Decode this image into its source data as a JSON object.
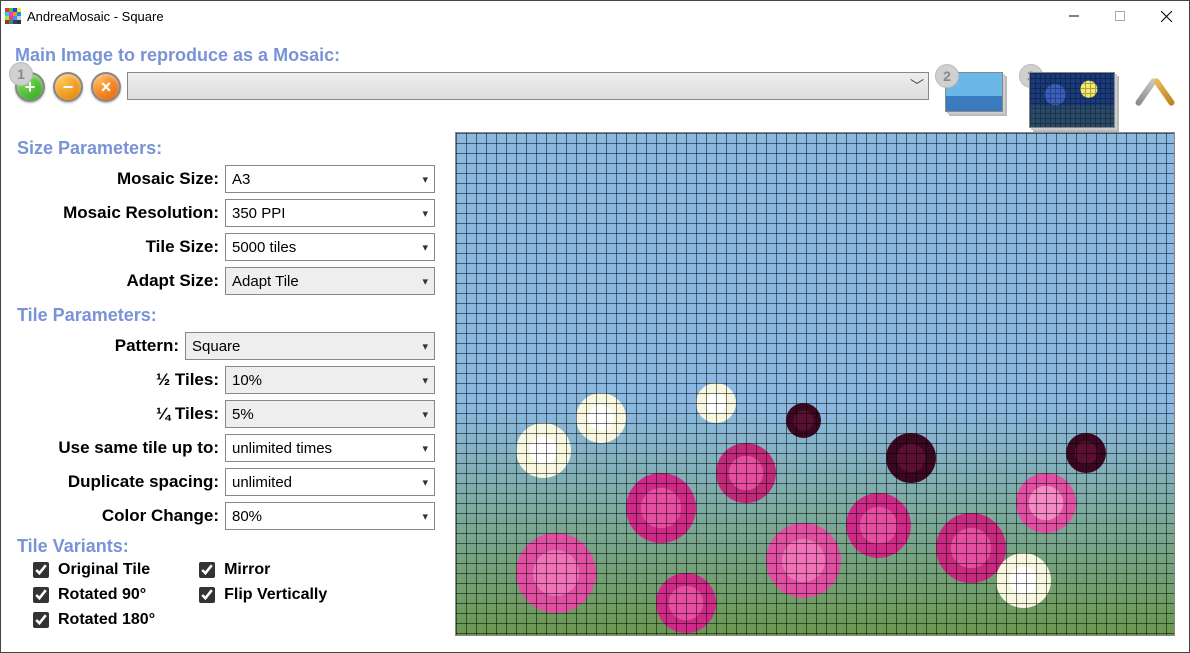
{
  "window": {
    "title": "AndreaMosaic - Square"
  },
  "header": {
    "main_label": "Main Image to reproduce as a Mosaic:"
  },
  "steps": {
    "one": "1",
    "two": "2",
    "three": "3"
  },
  "buttons": {
    "add": "+",
    "remove": "−",
    "clear": "×"
  },
  "sections": {
    "size": "Size Parameters:",
    "tile": "Tile Parameters:",
    "variants": "Tile Variants:"
  },
  "size": {
    "mosaic_size": {
      "label": "Mosaic Size:",
      "value": "A3"
    },
    "resolution": {
      "label": "Mosaic Resolution:",
      "value": "350 PPI"
    },
    "tile_size": {
      "label": "Tile Size:",
      "value": "5000 tiles"
    },
    "adapt": {
      "label": "Adapt Size:",
      "value": "Adapt Tile"
    }
  },
  "tile": {
    "pattern": {
      "label": "Pattern:",
      "value": "Square"
    },
    "half": {
      "label": "½ Tiles:",
      "value": "10%"
    },
    "quarter": {
      "label": "¼ Tiles:",
      "value": "5%"
    },
    "use_same": {
      "label": "Use same tile up to:",
      "value": "unlimited times"
    },
    "dup_spacing": {
      "label": "Duplicate spacing:",
      "value": "unlimited"
    },
    "color_change": {
      "label": "Color Change:",
      "value": "80%"
    }
  },
  "variants": {
    "original": "Original Tile",
    "rot90": "Rotated 90°",
    "rot180": "Rotated 180°",
    "mirror": "Mirror",
    "flipv": "Flip Vertically"
  }
}
